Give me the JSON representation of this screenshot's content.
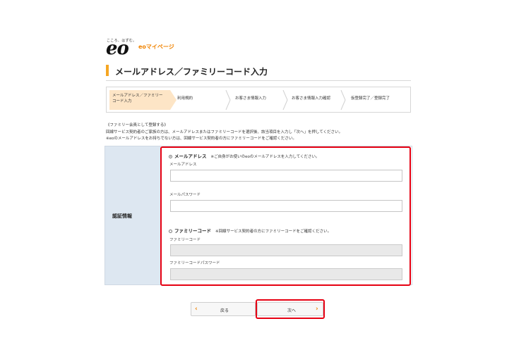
{
  "logo": {
    "tagline": "こころ、はずむ。",
    "brand": "eo",
    "mypage": "eoマイページ"
  },
  "page_title": "メールアドレス／ファミリーコード入力",
  "steps": [
    {
      "line1": "メールアドレス／ファミリー",
      "line2": "コード入力",
      "active": true
    },
    {
      "line1": "利用規約",
      "line2": "",
      "active": false
    },
    {
      "line1": "お客さま情報入力",
      "line2": "",
      "active": false
    },
    {
      "line1": "お客さま情報入力確認",
      "line2": "",
      "active": false
    },
    {
      "line1": "仮登録完了／登録完了",
      "line2": "",
      "active": false
    }
  ],
  "intro": {
    "line1": "《ファミリー会員として登録する》",
    "line2": "回線サービス契約者のご家族の方は、メールアドレスまたはファミリーコードを選択後、該当項目を入力し「次へ」を押してください。",
    "line3": "※eoのメールアドレスをお持ちでない方は、回線サービス契約者の方にファミリーコードをご確認ください。"
  },
  "auth": {
    "header": "認証情報",
    "email_option": {
      "label": "メールアドレス",
      "note": "※ご自身がお使いのeoのメールアドレスを入力してください。",
      "selected": true
    },
    "email_label": "メールアドレス",
    "email_value": "",
    "password_label": "メールパスワード",
    "password_value": "",
    "family_option": {
      "label": "ファミリーコード",
      "note": "※回線サービス契約者の方にファミリーコードをご確認ください。",
      "selected": false
    },
    "family_code_label": "ファミリーコード",
    "family_code_value": "",
    "family_password_label": "ファミリーコードパスワード",
    "family_password_value": ""
  },
  "buttons": {
    "back": "戻る",
    "next": "次へ",
    "back_arrow": "‹",
    "next_arrow": "›"
  },
  "colors": {
    "accent": "#f08300",
    "highlight": "#e60012",
    "panel_header": "#dde7f1",
    "active_step": "#fde5c6"
  }
}
